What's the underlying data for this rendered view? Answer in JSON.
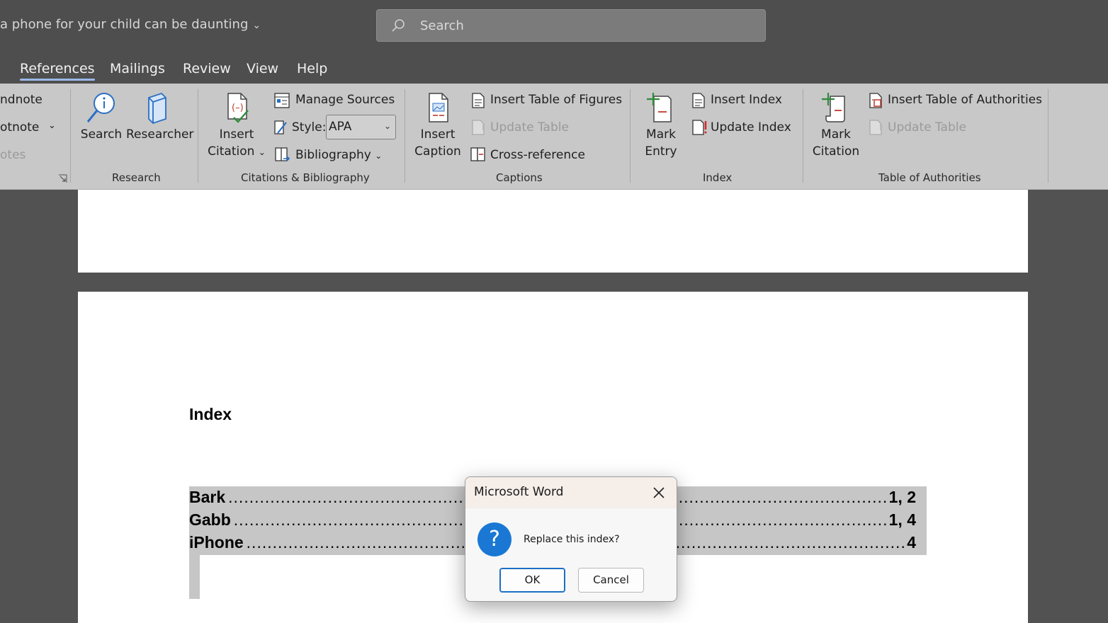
{
  "window": {
    "doc_title": "a phone for your child can be daunting",
    "search_placeholder": "Search"
  },
  "tabs": [
    {
      "label": "References",
      "active": true
    },
    {
      "label": "Mailings"
    },
    {
      "label": "Review"
    },
    {
      "label": "View"
    },
    {
      "label": "Help"
    }
  ],
  "ribbon": {
    "footnotes": {
      "endnote_label": "ndnote",
      "footnote_label": "otnote",
      "notes_label": "otes"
    },
    "research": {
      "search_label": "Search",
      "researcher_label": "Researcher",
      "group_label": "Research"
    },
    "citations": {
      "insert_citation_line1": "Insert",
      "insert_citation_line2": "Citation",
      "manage_sources": "Manage Sources",
      "style_label": "Style:",
      "style_value": "APA",
      "bibliography": "Bibliography",
      "group_label": "Citations & Bibliography"
    },
    "captions": {
      "insert_caption_line1": "Insert",
      "insert_caption_line2": "Caption",
      "insert_table_of_figures": "Insert Table of Figures",
      "update_table": "Update Table",
      "cross_reference": "Cross-reference",
      "group_label": "Captions"
    },
    "index": {
      "mark_entry_line1": "Mark",
      "mark_entry_line2": "Entry",
      "insert_index": "Insert Index",
      "update_index": "Update Index",
      "group_label": "Index"
    },
    "authorities": {
      "mark_citation_line1": "Mark",
      "mark_citation_line2": "Citation",
      "insert_table_of_authorities": "Insert Table of Authorities",
      "update_table": "Update Table",
      "group_label": "Table of Authorities"
    }
  },
  "document": {
    "index_heading": "Index",
    "entries": [
      {
        "term": "Bark",
        "pages": "1, 2"
      },
      {
        "term": "Gabb",
        "pages": "1, 4"
      },
      {
        "term": "iPhone",
        "pages": "4"
      }
    ]
  },
  "dialog": {
    "title": "Microsoft Word",
    "message": "Replace this index?",
    "ok_label": "OK",
    "cancel_label": "Cancel",
    "icon": "question-icon",
    "accent": "#1a78d4"
  }
}
